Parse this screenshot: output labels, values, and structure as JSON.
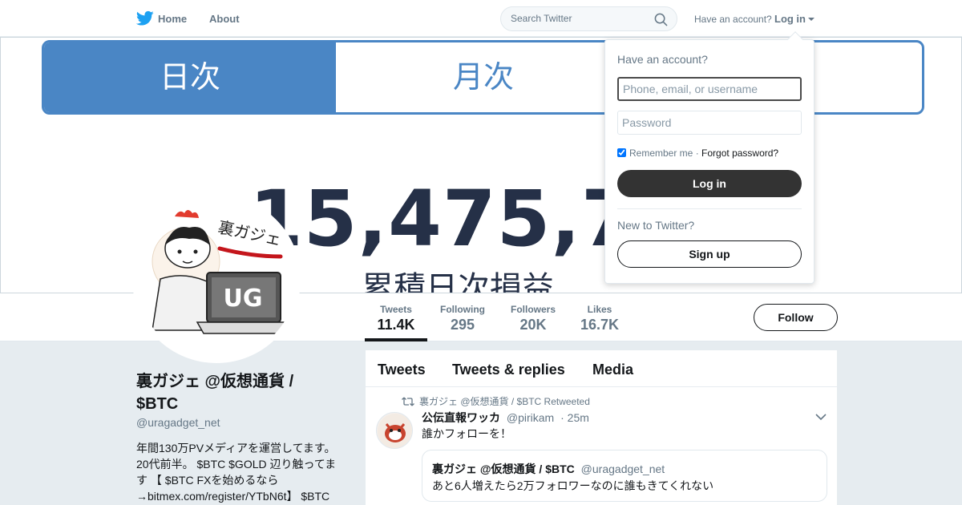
{
  "nav": {
    "logo_icon": "twitter-bird-icon",
    "home_label": "Home",
    "about_label": "About",
    "search_placeholder": "Search Twitter",
    "have_account": "Have an account?",
    "login_label": "Log in",
    "brand_color": "#1da1f2"
  },
  "banner": {
    "tab_daily": "日次",
    "tab_monthly": "月次",
    "number": "15,475,79",
    "subtitle": "累積日次損益",
    "accent_color": "#4a86c5"
  },
  "profile": {
    "stats": [
      {
        "label": "Tweets",
        "value": "11.4K"
      },
      {
        "label": "Following",
        "value": "295"
      },
      {
        "label": "Followers",
        "value": "20K"
      },
      {
        "label": "Likes",
        "value": "16.7K"
      }
    ],
    "follow_label": "Follow",
    "name": "裏ガジェ @仮想通貨 / $BTC",
    "handle": "@uragadget_net",
    "bio": "年間130万PVメディアを運営してます。20代前半。 $BTC $GOLD 辺り触ってます 【 $BTC FXを始めるなら→bitmex.com/register/YTbN6t】 $BTC",
    "avatar_text": "裏ガジェ",
    "avatar_badge": "UG"
  },
  "timeline": {
    "tabs": [
      "Tweets",
      "Tweets & replies",
      "Media"
    ],
    "tweet": {
      "retweet_label": "裏ガジェ @仮想通貨 / $BTC Retweeted",
      "name": "公伝直報ワッカ",
      "handle": "@pirikam",
      "time": "· 25m",
      "text": "誰かフォローを！",
      "quote": {
        "name": "裏ガジェ @仮想通貨 / $BTC",
        "handle": "@uragadget_net",
        "text": "あと6人増えたら2万フォロワーなのに誰もきてくれない"
      }
    }
  },
  "login_dropdown": {
    "heading": "Have an account?",
    "username_placeholder": "Phone, email, or username",
    "password_placeholder": "Password",
    "remember_label": "Remember me",
    "separator": "·",
    "forgot_label": "Forgot password?",
    "login_button": "Log in",
    "new_label": "New to Twitter?",
    "signup_button": "Sign up"
  }
}
